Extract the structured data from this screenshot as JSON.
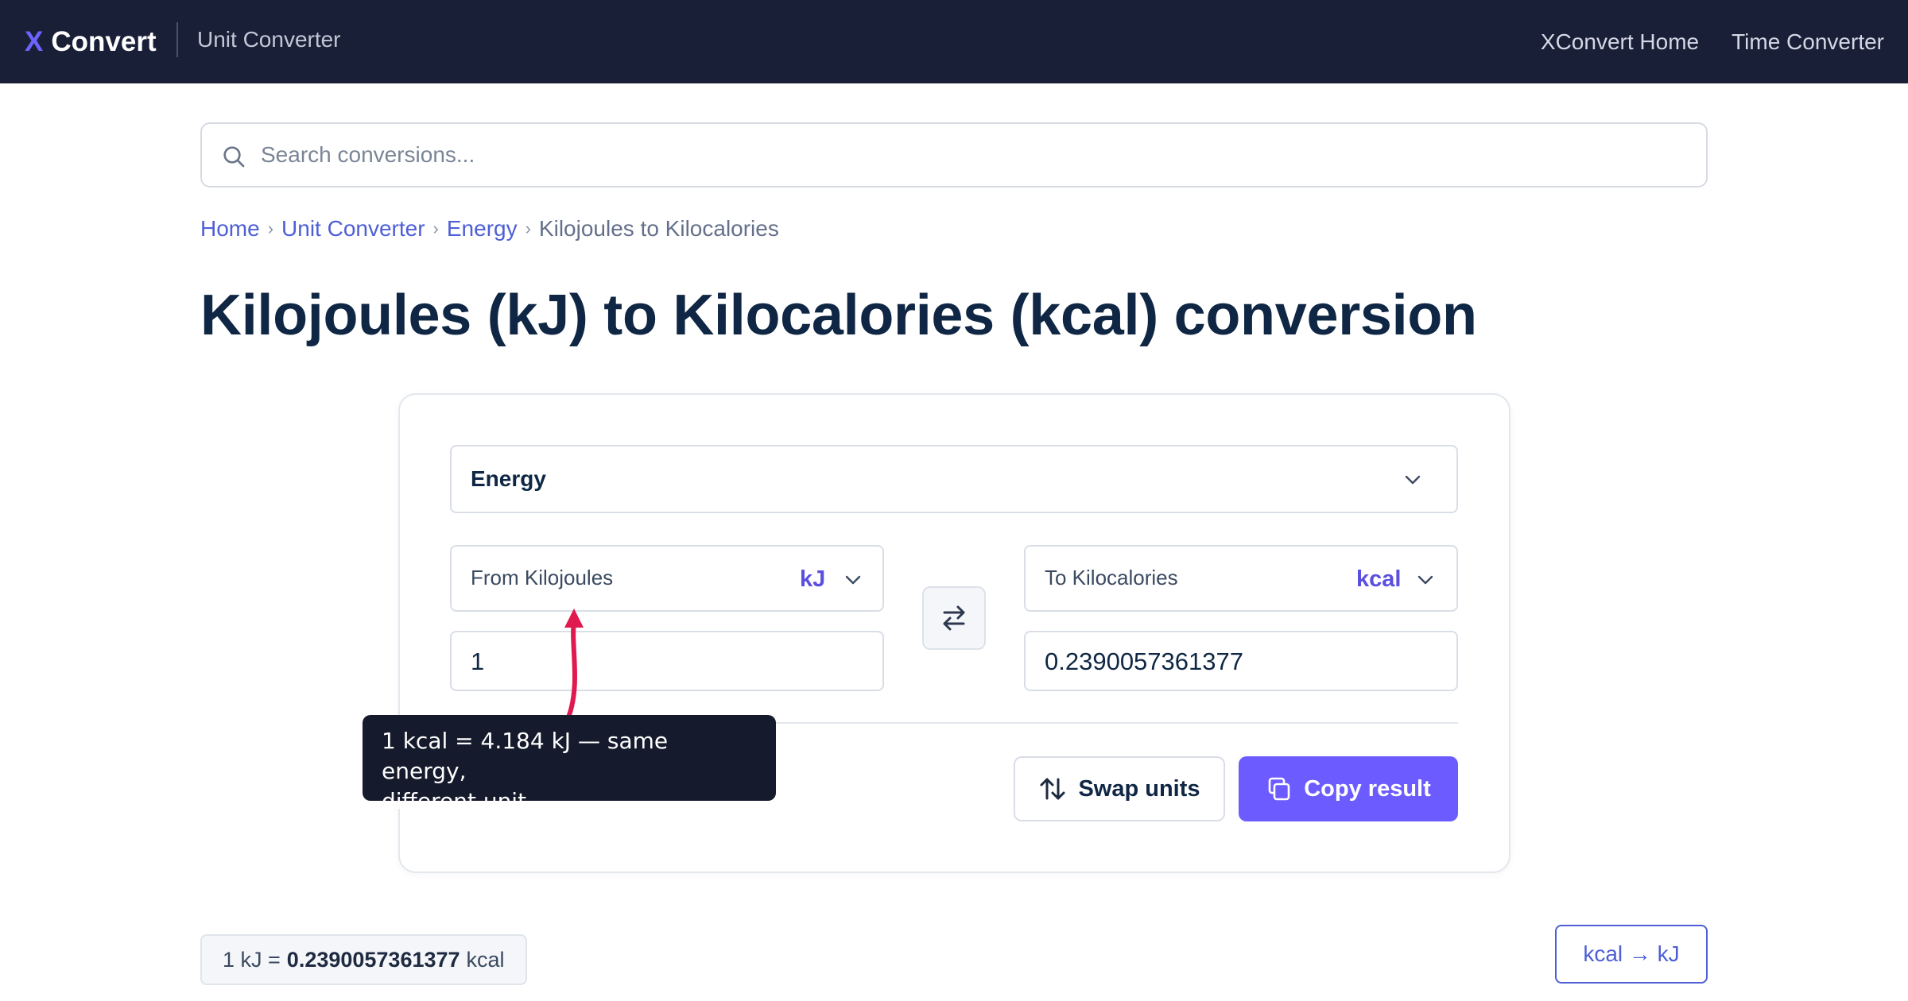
{
  "header": {
    "brand_x": "X",
    "brand_name": "Convert",
    "subtitle": "Unit Converter",
    "nav": [
      "XConvert Home",
      "Time Converter"
    ]
  },
  "search": {
    "placeholder": "Search conversions...",
    "value": ""
  },
  "breadcrumb": {
    "items": [
      "Home",
      "Unit Converter",
      "Energy"
    ],
    "current": "Kilojoules to Kilocalories",
    "separator": "›"
  },
  "page_title": "Kilojoules (kJ) to Kilocalories (kcal) conversion",
  "converter": {
    "category": "Energy",
    "from": {
      "label": "From Kilojoules",
      "abbr": "kJ",
      "value": "1"
    },
    "to": {
      "label": "To Kilocalories",
      "abbr": "kcal",
      "value": "0.2390057361377"
    },
    "swap_button": "Swap units",
    "copy_button": "Copy result"
  },
  "tooltip": {
    "line1": "1 kcal = 4.184 kJ — same energy,",
    "line2": "different unit"
  },
  "factor": {
    "prefix": "1 kJ =",
    "value": "0.2390057361377",
    "suffix": "kcal"
  },
  "reverse_link": "kcal → kJ",
  "colors": {
    "topbar": "#1a1f38",
    "accent": "#6c5cff",
    "link": "#4e5fd6",
    "annotation_arrow": "#e0194f"
  },
  "icons": [
    "search-icon",
    "chevron-down-icon",
    "swap-horizontal-icon",
    "swap-vertical-icon",
    "copy-icon"
  ]
}
